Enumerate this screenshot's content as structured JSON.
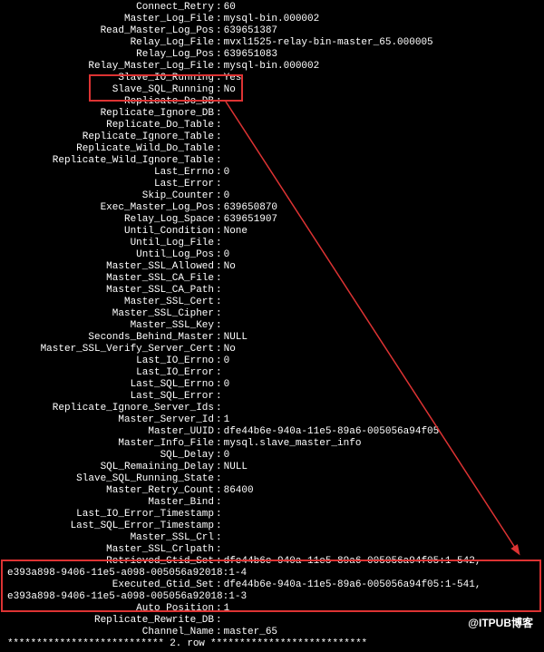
{
  "rows": [
    {
      "label": "Connect_Retry",
      "value": "60"
    },
    {
      "label": "Master_Log_File",
      "value": "mysql-bin.000002"
    },
    {
      "label": "Read_Master_Log_Pos",
      "value": "639651387"
    },
    {
      "label": "Relay_Log_File",
      "value": "mvxl1525-relay-bin-master_65.000005"
    },
    {
      "label": "Relay_Log_Pos",
      "value": "639651083"
    },
    {
      "label": "Relay_Master_Log_File",
      "value": "mysql-bin.000002"
    },
    {
      "label": "Slave_IO_Running",
      "value": "Yes"
    },
    {
      "label": "Slave_SQL_Running",
      "value": "No"
    },
    {
      "label": "Replicate_Do_DB",
      "value": ""
    },
    {
      "label": "Replicate_Ignore_DB",
      "value": ""
    },
    {
      "label": "Replicate_Do_Table",
      "value": ""
    },
    {
      "label": "Replicate_Ignore_Table",
      "value": ""
    },
    {
      "label": "Replicate_Wild_Do_Table",
      "value": ""
    },
    {
      "label": "Replicate_Wild_Ignore_Table",
      "value": ""
    },
    {
      "label": "Last_Errno",
      "value": "0"
    },
    {
      "label": "Last_Error",
      "value": ""
    },
    {
      "label": "Skip_Counter",
      "value": "0"
    },
    {
      "label": "Exec_Master_Log_Pos",
      "value": "639650870"
    },
    {
      "label": "Relay_Log_Space",
      "value": "639651907"
    },
    {
      "label": "Until_Condition",
      "value": "None"
    },
    {
      "label": "Until_Log_File",
      "value": ""
    },
    {
      "label": "Until_Log_Pos",
      "value": "0"
    },
    {
      "label": "Master_SSL_Allowed",
      "value": "No"
    },
    {
      "label": "Master_SSL_CA_File",
      "value": ""
    },
    {
      "label": "Master_SSL_CA_Path",
      "value": ""
    },
    {
      "label": "Master_SSL_Cert",
      "value": ""
    },
    {
      "label": "Master_SSL_Cipher",
      "value": ""
    },
    {
      "label": "Master_SSL_Key",
      "value": ""
    },
    {
      "label": "Seconds_Behind_Master",
      "value": "NULL"
    },
    {
      "label": "Master_SSL_Verify_Server_Cert",
      "value": "No"
    },
    {
      "label": "Last_IO_Errno",
      "value": "0"
    },
    {
      "label": "Last_IO_Error",
      "value": ""
    },
    {
      "label": "Last_SQL_Errno",
      "value": "0"
    },
    {
      "label": "Last_SQL_Error",
      "value": ""
    },
    {
      "label": "Replicate_Ignore_Server_Ids",
      "value": ""
    },
    {
      "label": "Master_Server_Id",
      "value": "1"
    },
    {
      "label": "Master_UUID",
      "value": "dfe44b6e-940a-11e5-89a6-005056a94f05"
    },
    {
      "label": "Master_Info_File",
      "value": "mysql.slave_master_info"
    },
    {
      "label": "SQL_Delay",
      "value": "0"
    },
    {
      "label": "SQL_Remaining_Delay",
      "value": "NULL"
    },
    {
      "label": "Slave_SQL_Running_State",
      "value": ""
    },
    {
      "label": "Master_Retry_Count",
      "value": "86400"
    },
    {
      "label": "Master_Bind",
      "value": ""
    },
    {
      "label": "Last_IO_Error_Timestamp",
      "value": ""
    },
    {
      "label": "Last_SQL_Error_Timestamp",
      "value": ""
    },
    {
      "label": "Master_SSL_Crl",
      "value": ""
    },
    {
      "label": "Master_SSL_Crlpath",
      "value": ""
    }
  ],
  "wraps": [
    {
      "label": "Retrieved_Gtid_Set",
      "value": "dfe44b6e-940a-11e5-89a6-005056a94f05:1-542,",
      "wrap": "e393a898-9406-11e5-a098-005056a92018:1-4"
    },
    {
      "label": "Executed_Gtid_Set",
      "value": "dfe44b6e-940a-11e5-89a6-005056a94f05:1-541,",
      "wrap": "e393a898-9406-11e5-a098-005056a92018:1-3"
    }
  ],
  "tail": [
    {
      "label": "Auto_Position",
      "value": "1"
    },
    {
      "label": "Replicate_Rewrite_DB",
      "value": ""
    },
    {
      "label": "Channel_Name",
      "value": "master_65"
    }
  ],
  "truncated_line": "*************************** 2. row ***************************",
  "watermark": "@ITPUB博客"
}
